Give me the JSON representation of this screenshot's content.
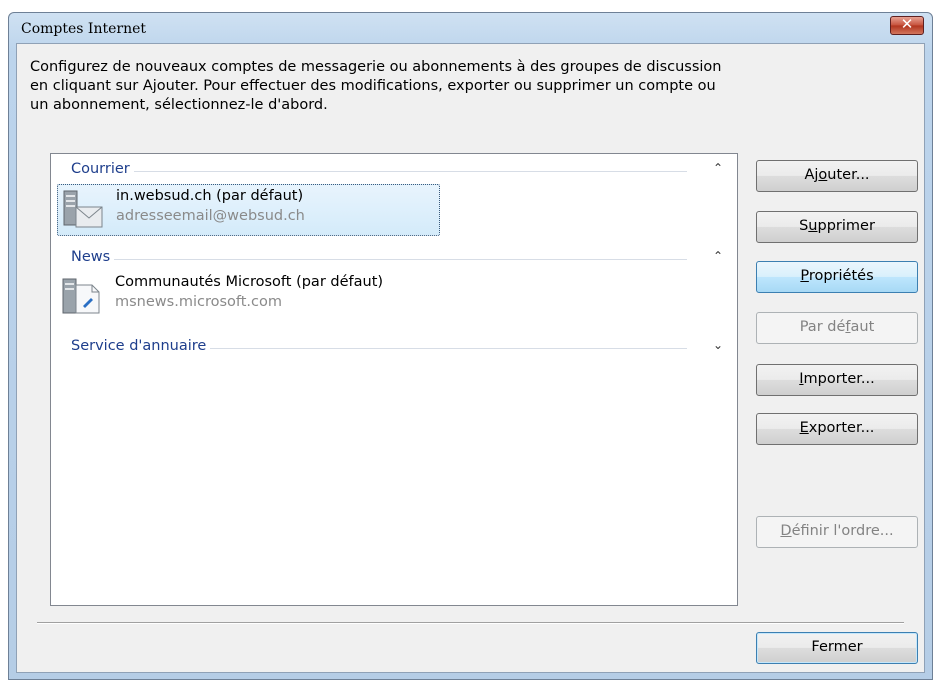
{
  "window": {
    "title": "Comptes Internet",
    "close_glyph": "✕"
  },
  "description": "Configurez de nouveaux comptes de messagerie ou abonnements à des groupes de discussion en cliquant sur Ajouter. Pour effectuer des modifications, exporter ou supprimer un compte ou un abonnement, sélectionnez-le d'abord.",
  "groups": [
    {
      "label": "Courrier",
      "chevron": "⌃",
      "expanded": true,
      "items": [
        {
          "name": "in.websud.ch (par défaut)",
          "sub": "adresseemail@websud.ch",
          "selected": true,
          "icon": "mail-account-icon"
        }
      ]
    },
    {
      "label": "News",
      "chevron": "⌃",
      "expanded": true,
      "items": [
        {
          "name": "Communautés Microsoft (par défaut)",
          "sub": "msnews.microsoft.com",
          "selected": false,
          "icon": "news-server-icon"
        }
      ]
    },
    {
      "label": "Service d'annuaire",
      "chevron": "⌄",
      "expanded": false,
      "items": []
    }
  ],
  "buttons": {
    "add": {
      "pre": "Aj",
      "key": "o",
      "post": "uter..."
    },
    "remove": {
      "pre": "S",
      "key": "u",
      "post": "pprimer"
    },
    "properties": {
      "pre": "",
      "key": "P",
      "post": "ropriétés"
    },
    "default": {
      "pre": "Par dé",
      "key": "f",
      "post": "aut"
    },
    "import": {
      "pre": "",
      "key": "I",
      "post": "mporter..."
    },
    "export": {
      "pre": "",
      "key": "E",
      "post": "xporter..."
    },
    "set_order": {
      "pre": "",
      "key": "D",
      "post": "éfinir l'ordre..."
    },
    "close": {
      "label": "Fermer"
    }
  },
  "colors": {
    "group_label": "#1e3e8c",
    "selection": "#d4ebfa",
    "active_button": "#bee6fd"
  }
}
